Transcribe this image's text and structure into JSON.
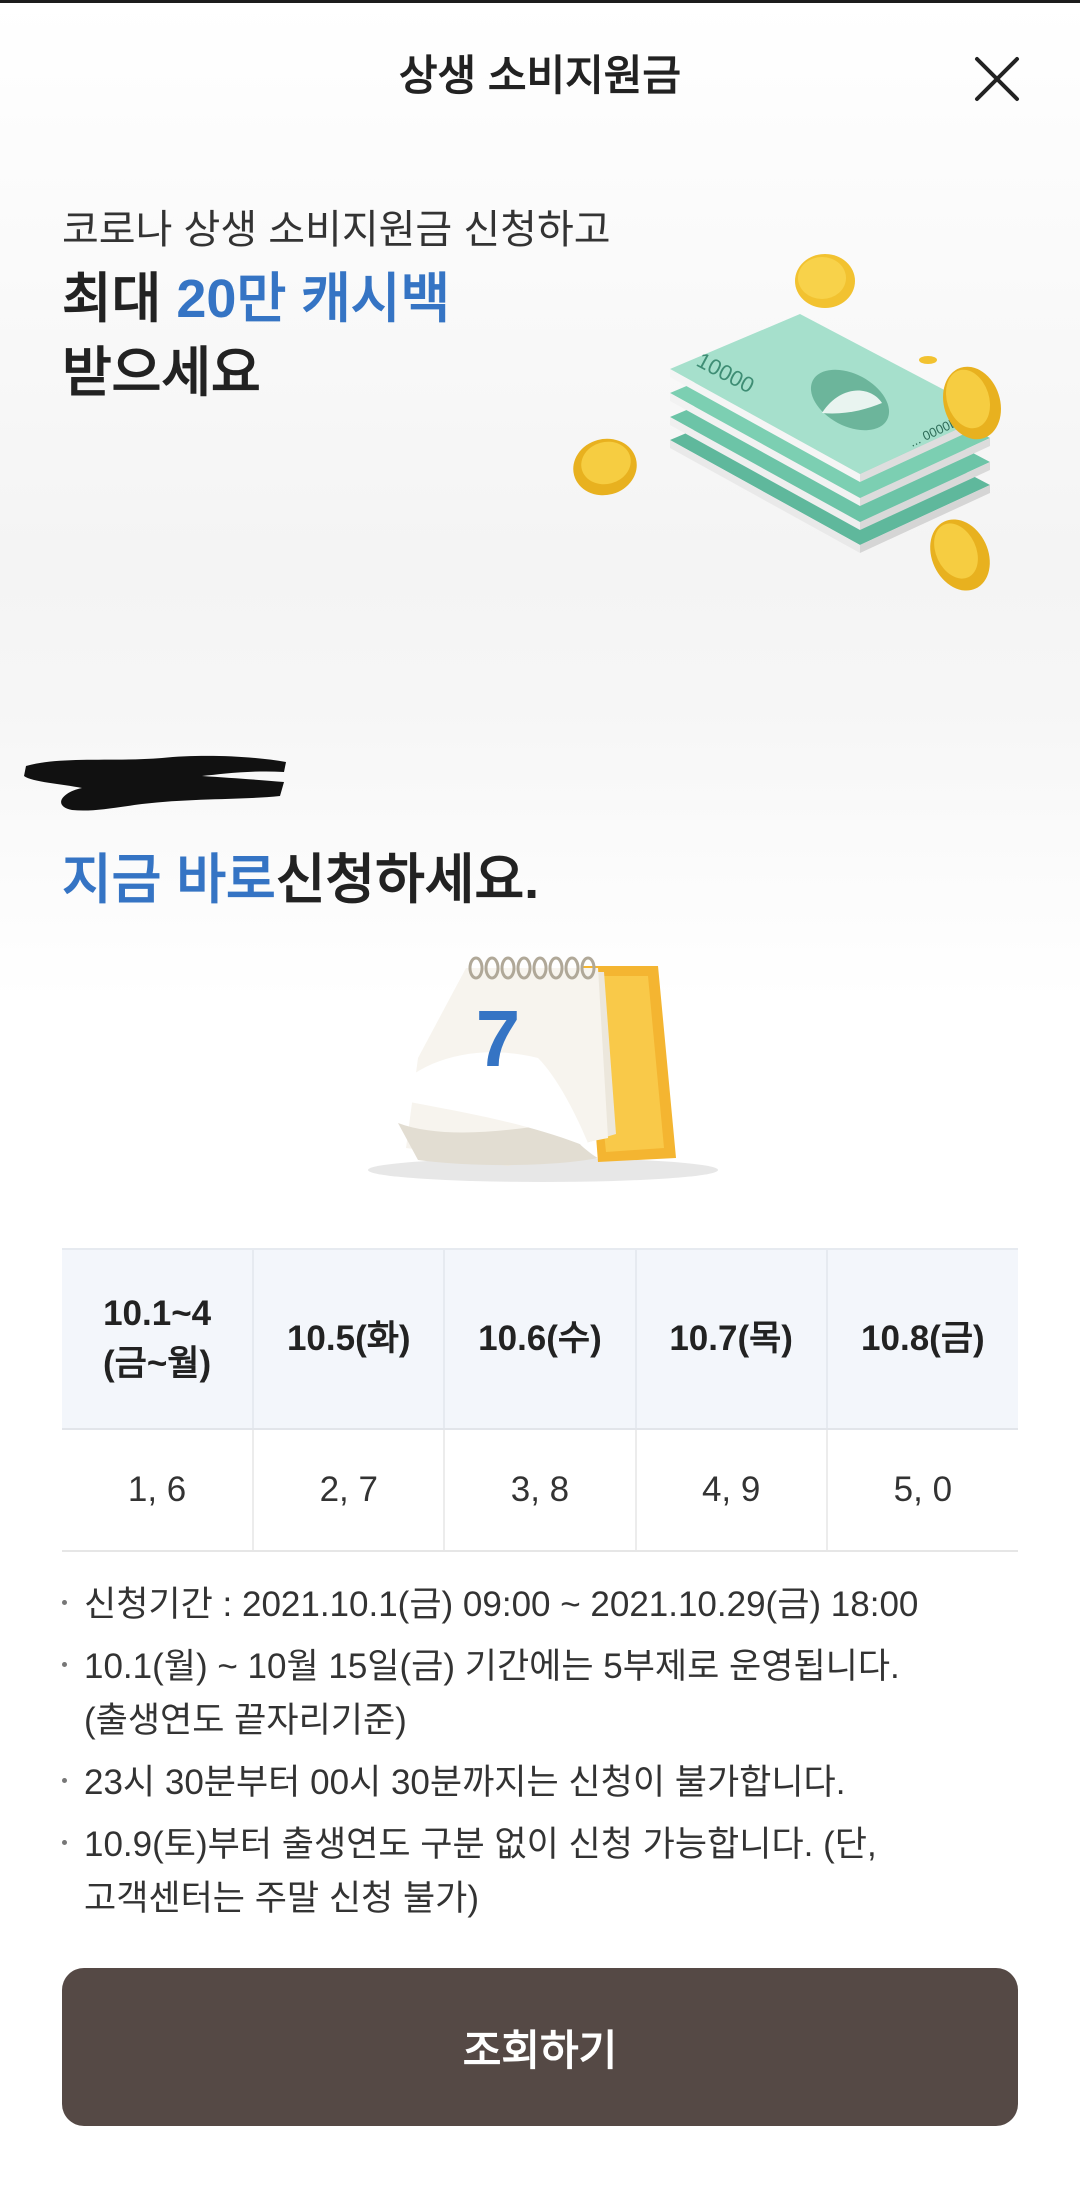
{
  "header": {
    "title": "상생 소비지원금"
  },
  "intro": {
    "line1": "코로나 상생 소비지원금 신청하고",
    "line2_prefix": "최대 ",
    "line2_highlight": "20만 캐시백",
    "line3": "받으세요"
  },
  "prompt": {
    "highlight": "지금 바로",
    "rest": "신청하세요."
  },
  "calendar": {
    "day": "7"
  },
  "schedule": {
    "headers": [
      {
        "top": "10.1~4",
        "bottom": "(금~월)"
      },
      {
        "top": "10.5(화)",
        "bottom": ""
      },
      {
        "top": "10.6(수)",
        "bottom": ""
      },
      {
        "top": "10.7(목)",
        "bottom": ""
      },
      {
        "top": "10.8(금)",
        "bottom": ""
      }
    ],
    "digits": [
      "1, 6",
      "2, 7",
      "3, 8",
      "4, 9",
      "5, 0"
    ]
  },
  "notes": [
    {
      "text": "신청기간 : 2021.10.1(금) 09:00 ~ 2021.10.29(금) 18:00",
      "sub": ""
    },
    {
      "text": "10.1(월) ~ 10월 15일(금) 기간에는 5부제로 운영됩니다.",
      "sub": "(출생연도 끝자리기준)"
    },
    {
      "text": "23시 30분부터 00시 30분까지는 신청이 불가합니다.",
      "sub": ""
    },
    {
      "text": "10.9(토)부터 출생연도 구분 없이 신청 가능합니다. (단,",
      "sub": "고객센터는 주말 신청 불가)"
    }
  ],
  "cta": {
    "label": "조회하기"
  },
  "illustration": {
    "banknote_text": "10000",
    "banknote_serial": "... 0000L"
  },
  "colors": {
    "accent": "#3574c4",
    "button": "#554945",
    "table_header_bg": "#f3f6fb"
  },
  "icons": {
    "close": "close-icon"
  }
}
